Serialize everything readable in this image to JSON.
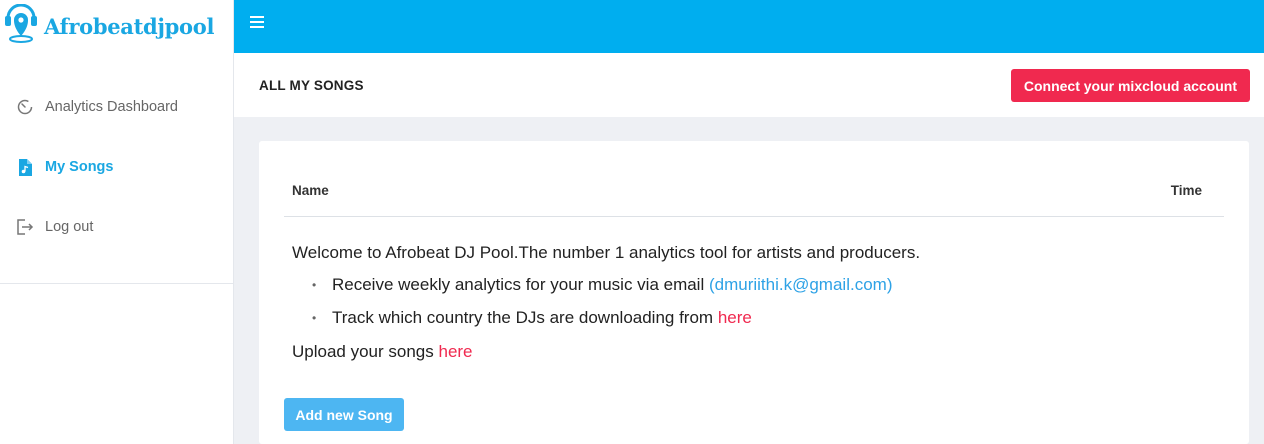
{
  "brand": {
    "name": "Afrobeatdjpool",
    "logo_icon": "dj-headphones-pin-icon"
  },
  "colors": {
    "topbar": "#00aeef",
    "accent_blue": "#1aa7e2",
    "danger_red": "#f0294f",
    "button_blue": "#4db6f2"
  },
  "sidebar": {
    "items": [
      {
        "label": "Analytics Dashboard",
        "icon": "dashboard-gauge-icon",
        "active": false
      },
      {
        "label": "My Songs",
        "icon": "music-file-icon",
        "active": true
      },
      {
        "label": "Log out",
        "icon": "logout-icon",
        "active": false
      }
    ]
  },
  "topbar": {
    "menu_icon": "hamburger-icon"
  },
  "subheader": {
    "title": "ALL MY SONGS",
    "connect_label": "Connect your mixcloud account"
  },
  "table": {
    "columns": [
      "Name",
      "Time"
    ]
  },
  "content": {
    "welcome": "Welcome to Afrobeat DJ Pool.The number 1 analytics tool for artists and producers.",
    "bullet1_text": "Receive weekly analytics for your music via email ",
    "bullet1_link": "(dmuriithi.k@gmail.com)",
    "bullet2_text": "Track which country the DJs are downloading from ",
    "bullet2_link": "here",
    "upload_text": "Upload your songs ",
    "upload_link": "here",
    "bullet_glyph": "•"
  },
  "actions": {
    "add_label": "Add new Song"
  }
}
